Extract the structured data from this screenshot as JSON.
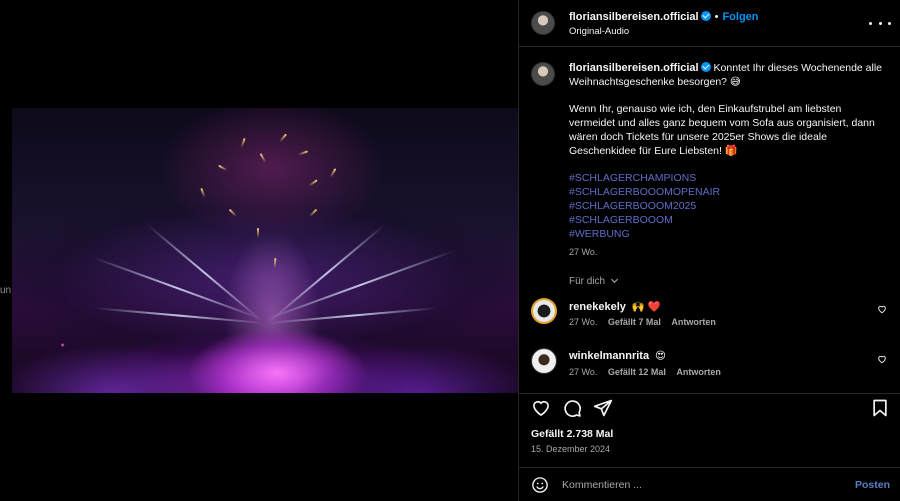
{
  "media": {
    "side_hint": "un",
    "mute_icon": "speaker-muted-icon"
  },
  "header": {
    "username": "floriansilbereisen.official",
    "separator": "•",
    "follow_label": "Folgen",
    "audio": "Original-Audio",
    "more_icon": "more-horizontal-icon"
  },
  "caption": {
    "username": "floriansilbereisen.official",
    "line1": "Konntet Ihr dieses Wochenende alle Weihnachtsgeschenke besorgen? 😅",
    "line2": "Wenn Ihr, genauso wie ich, den Einkaufstrubel am liebsten vermeidet und alles ganz bequem vom Sofa aus organisiert, dann wären doch Tickets für unsere 2025er Shows die ideale Geschenkidee für Eure Liebsten! 🎁",
    "hashtags": [
      "#SCHLAGERCHAMPIONS",
      "#SCHLAGERBOOOMOPENAIR",
      "#SCHLAGERBOOOM2025",
      "#SCHLAGERBOOOM",
      "#WERBUNG"
    ],
    "age": "27 Wo."
  },
  "filter_label": "Für dich",
  "comments": [
    {
      "username": "renekekely",
      "text": "🙌 ❤️",
      "age": "27 Wo.",
      "likes": "Gefällt 7 Mal",
      "reply": "Antworten"
    },
    {
      "username": "winkelmannrita",
      "text": "😍",
      "age": "27 Wo.",
      "likes": "Gefällt 12 Mal",
      "reply": "Antworten"
    }
  ],
  "footer": {
    "likes": "Gefällt 2.738 Mal",
    "date": "15. Dezember 2024",
    "comment_placeholder": "Kommentieren ...",
    "post_label": "Posten"
  },
  "colors": {
    "accent": "#0095f6",
    "background": "#000000",
    "muted_text": "#a8a8a8",
    "divider": "#262626"
  }
}
